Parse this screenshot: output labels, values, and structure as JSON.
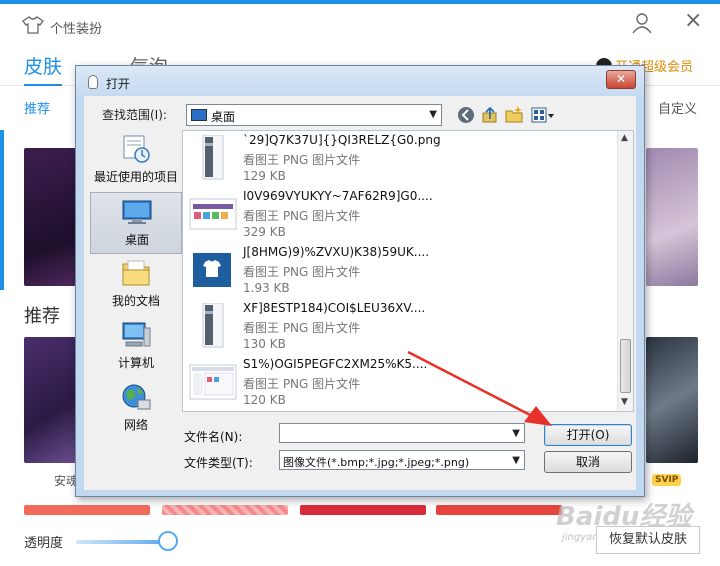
{
  "app": {
    "title": "个性装扮",
    "tabs": [
      {
        "label": "皮肤"
      },
      {
        "label": "气泡"
      }
    ],
    "vip_link": "开通超级会员",
    "subnav": {
      "first": "推荐",
      "custom": "自定义"
    },
    "section_title": "推荐",
    "captions": {
      "left": "安魂",
      "right_badge": "SVIP"
    },
    "opacity_label": "透明度",
    "opacity_value": 1.0,
    "restore_button": "恢复默认皮肤",
    "watermark": "Baidu经验",
    "watermark_url": "jingyan.baidu.com"
  },
  "dialog": {
    "title": "打开",
    "close_label": "✕",
    "look_in_label": "查找范围(I):",
    "look_in_value": "桌面",
    "places": [
      {
        "label": "最近使用的项目",
        "icon": "recent-icon"
      },
      {
        "label": "桌面",
        "icon": "desktop-icon",
        "selected": true
      },
      {
        "label": "我的文档",
        "icon": "folder-icon"
      },
      {
        "label": "计算机",
        "icon": "computer-icon"
      },
      {
        "label": "网络",
        "icon": "network-icon"
      }
    ],
    "files": [
      {
        "name": "`29]Q7K37U]{}QI3RELZ{G0.png",
        "type": "看图王 PNG 图片文件",
        "size": "129 KB"
      },
      {
        "name": "I0V969VYUKYY~7AF62R9]G0....",
        "type": "看图王 PNG 图片文件",
        "size": "329 KB"
      },
      {
        "name": "J[8HMG)9)%ZVXU)K38)59UK....",
        "type": "看图王 PNG 图片文件",
        "size": "1.93 KB"
      },
      {
        "name": "XF]8ESTP184)COI$LEU36XV....",
        "type": "看图王 PNG 图片文件",
        "size": "130 KB"
      },
      {
        "name": "S1%)OGI5PEGFC2XM25%K5....",
        "type": "看图王 PNG 图片文件",
        "size": "120 KB"
      }
    ],
    "filename_label": "文件名(N):",
    "filename_value": "",
    "filetype_label": "文件类型(T):",
    "filetype_value": "图像文件(*.bmp;*.jpg;*.jpeg;*.png)",
    "open_button": "打开(O)",
    "cancel_button": "取消"
  },
  "colors": {
    "accent": "#1e90e8",
    "vip": "#e08a00",
    "arrow": "#e8312a"
  }
}
